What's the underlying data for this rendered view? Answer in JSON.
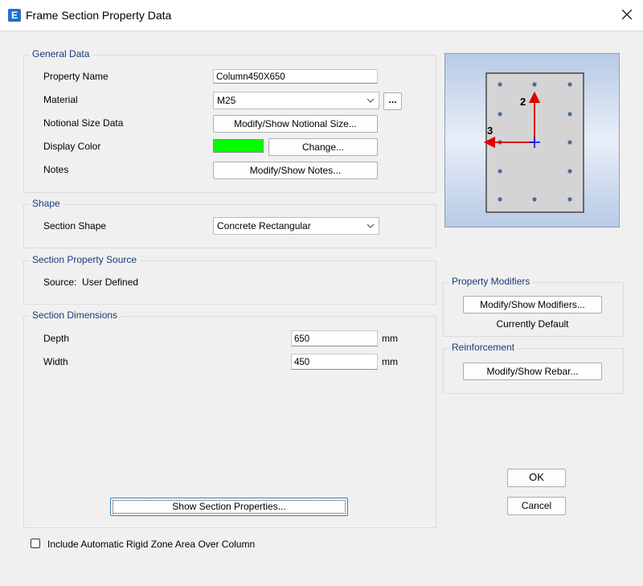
{
  "window": {
    "title": "Frame Section Property Data",
    "app_icon_letter": "E"
  },
  "general_data": {
    "legend": "General Data",
    "property_name_label": "Property Name",
    "property_name_value": "Column450X650",
    "material_label": "Material",
    "material_value": "M25",
    "material_more_button": "...",
    "notional_size_label": "Notional Size Data",
    "notional_size_button": "Modify/Show Notional Size...",
    "display_color_label": "Display Color",
    "display_color_value": "#00ff00",
    "change_button": "Change...",
    "notes_label": "Notes",
    "notes_button": "Modify/Show Notes..."
  },
  "shape": {
    "legend": "Shape",
    "section_shape_label": "Section Shape",
    "section_shape_value": "Concrete Rectangular"
  },
  "section_property_source": {
    "legend": "Section Property Source",
    "source_text": "Source:  User Defined"
  },
  "section_dimensions": {
    "legend": "Section Dimensions",
    "depth_label": "Depth",
    "depth_value": "650",
    "depth_unit": "mm",
    "width_label": "Width",
    "width_value": "450",
    "width_unit": "mm",
    "show_properties_button": "Show Section Properties..."
  },
  "preview": {
    "axis_2_label": "2",
    "axis_3_label": "3"
  },
  "property_modifiers": {
    "legend": "Property Modifiers",
    "button": "Modify/Show Modifiers...",
    "status": "Currently Default"
  },
  "reinforcement": {
    "legend": "Reinforcement",
    "button": "Modify/Show Rebar..."
  },
  "footer": {
    "ok_button": "OK",
    "cancel_button": "Cancel",
    "rigid_zone_checkbox_label": "Include Automatic Rigid Zone Area Over Column",
    "rigid_zone_checked": false
  },
  "colors": {
    "legend_text": "#1a3a7a",
    "preview_bg": "#b3c6e4",
    "axis_arrow": "#e00000",
    "origin_marker": "#0000ff",
    "rebar_dot": "#4a6e96"
  }
}
